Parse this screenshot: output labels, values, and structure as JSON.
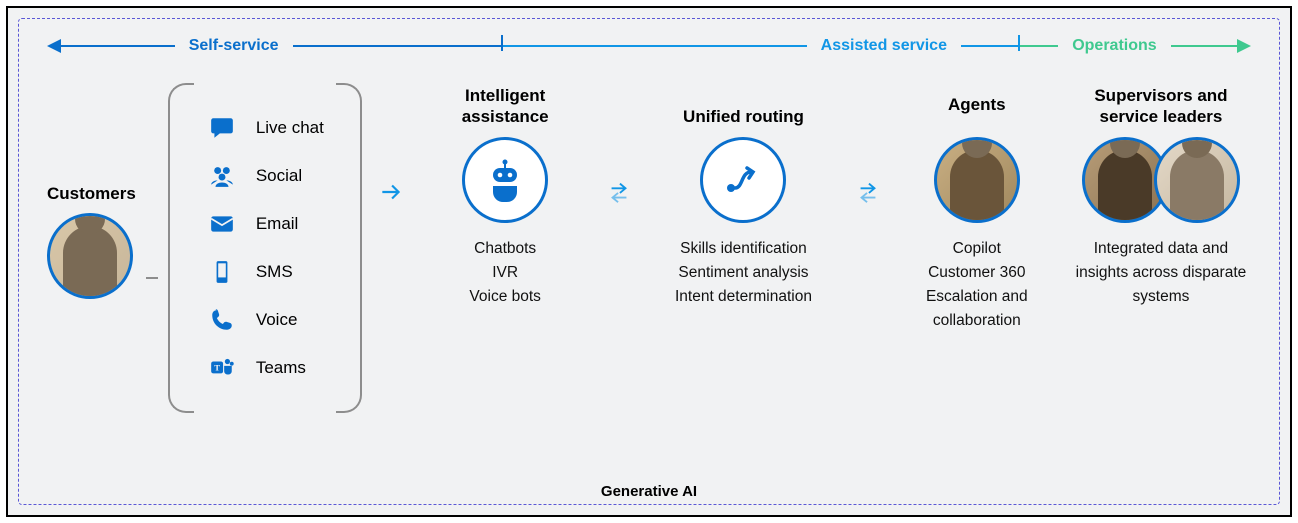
{
  "spectrum": {
    "self_service": "Self-service",
    "assisted_service": "Assisted service",
    "operations": "Operations"
  },
  "customers": {
    "title": "Customers",
    "channels": [
      {
        "icon": "chat-bubble-icon",
        "label": "Live chat"
      },
      {
        "icon": "people-group-icon",
        "label": "Social"
      },
      {
        "icon": "envelope-icon",
        "label": "Email"
      },
      {
        "icon": "phone-device-icon",
        "label": "SMS"
      },
      {
        "icon": "phone-handset-icon",
        "label": "Voice"
      },
      {
        "icon": "teams-icon",
        "label": "Teams"
      }
    ]
  },
  "columns": {
    "intelligent": {
      "title": "Intelligent assistance",
      "features": [
        "Chatbots",
        "IVR",
        "Voice bots"
      ]
    },
    "routing": {
      "title": "Unified routing",
      "features": [
        "Skills identification",
        "Sentiment analysis",
        "Intent determination"
      ]
    },
    "agents": {
      "title": "Agents",
      "features": [
        "Copilot",
        "Customer 360",
        "Escalation and collaboration"
      ]
    },
    "supervisors": {
      "title": "Supervisors and service leaders",
      "features_text": "Integrated data and insights across disparate systems"
    }
  },
  "footer": "Generative AI"
}
